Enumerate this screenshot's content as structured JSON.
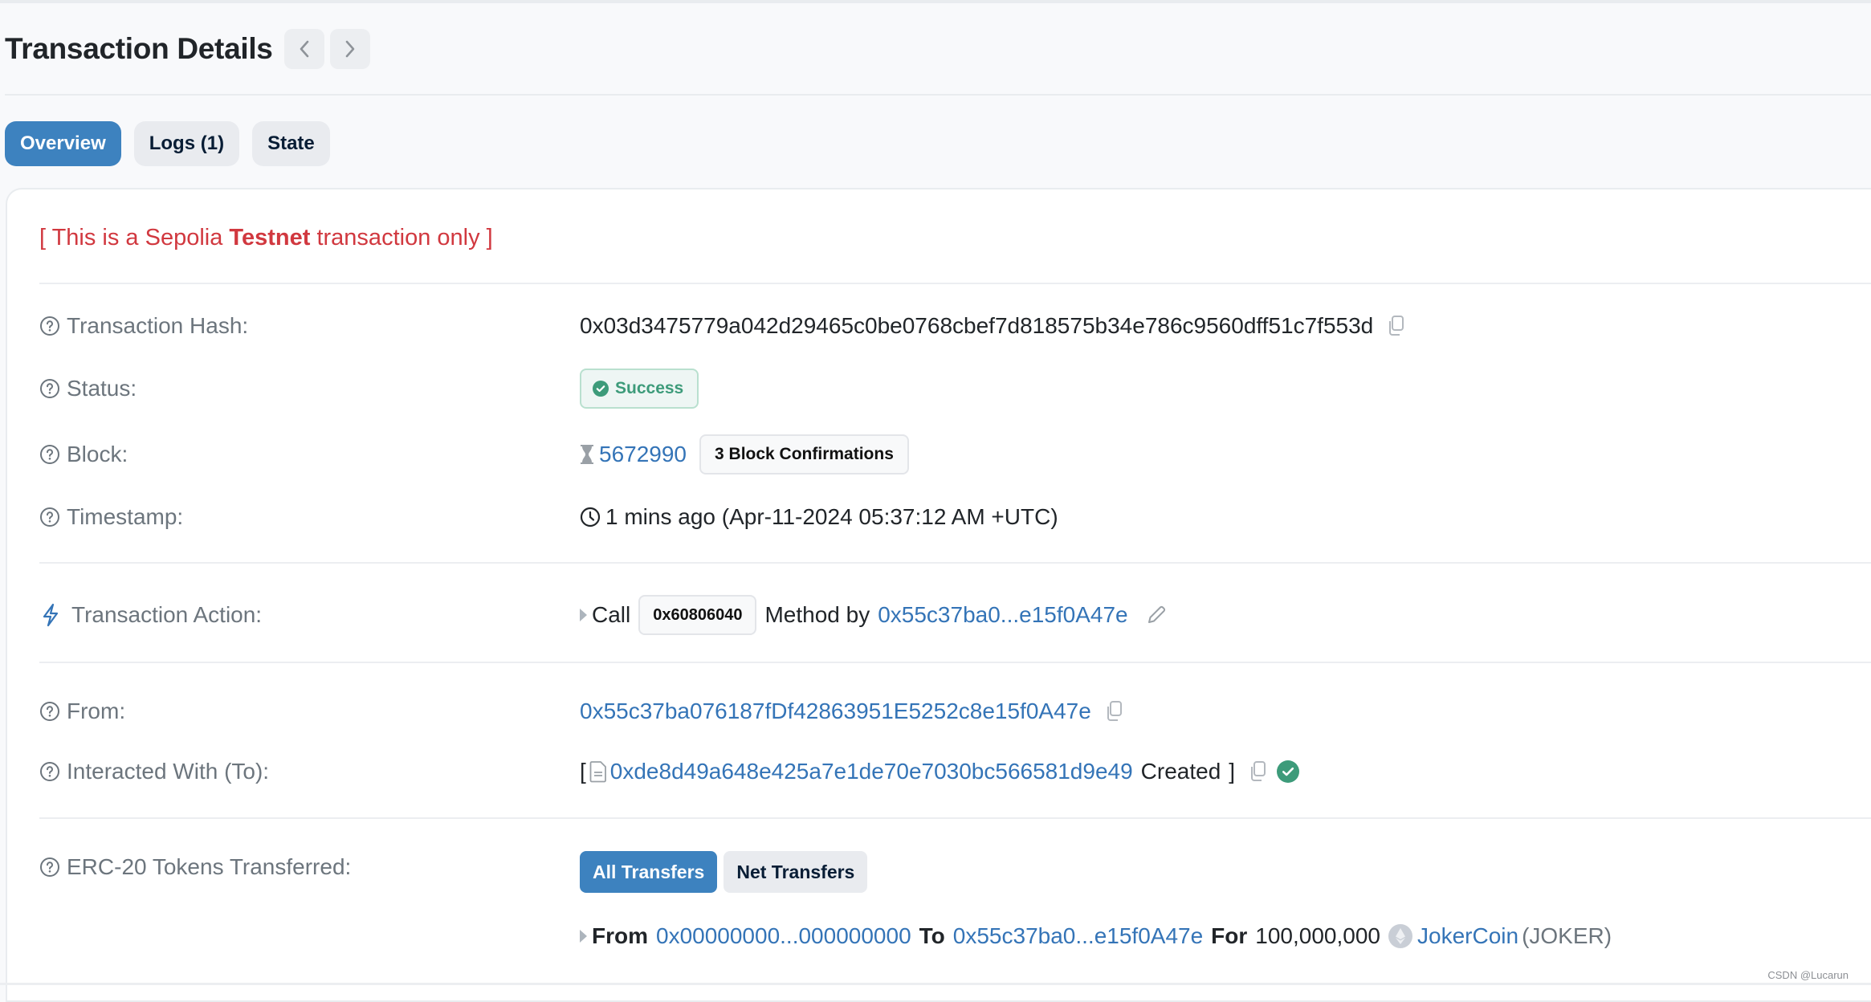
{
  "header": {
    "title": "Transaction Details",
    "prev_icon": "chevron-left-icon",
    "next_icon": "chevron-right-icon"
  },
  "tabs": [
    {
      "label": "Overview",
      "active": true
    },
    {
      "label": "Logs (1)",
      "active": false
    },
    {
      "label": "State",
      "active": false
    }
  ],
  "notice": {
    "prefix": "[ This is a Sepolia ",
    "emphasis": "Testnet",
    "suffix": " transaction only ]"
  },
  "fields": {
    "hash": {
      "label": "Transaction Hash:",
      "value": "0x03d3475779a042d29465c0be0768cbef7d818575b34e786c9560dff51c7f553d"
    },
    "status": {
      "label": "Status:",
      "value": "Success"
    },
    "block": {
      "label": "Block:",
      "value": "5672990",
      "confirmations": "3 Block Confirmations"
    },
    "timestamp": {
      "label": "Timestamp:",
      "value": "1 mins ago (Apr-11-2024 05:37:12 AM +UTC)"
    },
    "action": {
      "label": "Transaction Action:",
      "call": "Call",
      "method_id": "0x60806040",
      "method_by": "Method by",
      "address": "0x55c37ba0...e15f0A47e"
    },
    "from": {
      "label": "From:",
      "value": "0x55c37ba076187fDf42863951E5252c8e15f0A47e"
    },
    "to": {
      "label": "Interacted With (To):",
      "open": "[",
      "address": "0xde8d49a648e425a7e1de70e7030bc566581d9e49",
      "created": "Created",
      "close": "]"
    },
    "erc20": {
      "label": "ERC-20 Tokens Transferred:",
      "filters": [
        {
          "label": "All Transfers",
          "active": true
        },
        {
          "label": "Net Transfers",
          "active": false
        }
      ],
      "transfers": [
        {
          "from_label": "From",
          "from": "0x00000000...000000000",
          "to_label": "To",
          "to": "0x55c37ba0...e15f0A47e",
          "for_label": "For",
          "amount": "100,000,000",
          "token_name": "JokerCoin",
          "token_symbol": "(JOKER)"
        }
      ]
    }
  },
  "colors": {
    "accent": "#3d82bf",
    "link": "#3474b7",
    "success": "#3d9b7a",
    "testnet_red": "#d1383f"
  },
  "watermark": "CSDN @Lucarun"
}
